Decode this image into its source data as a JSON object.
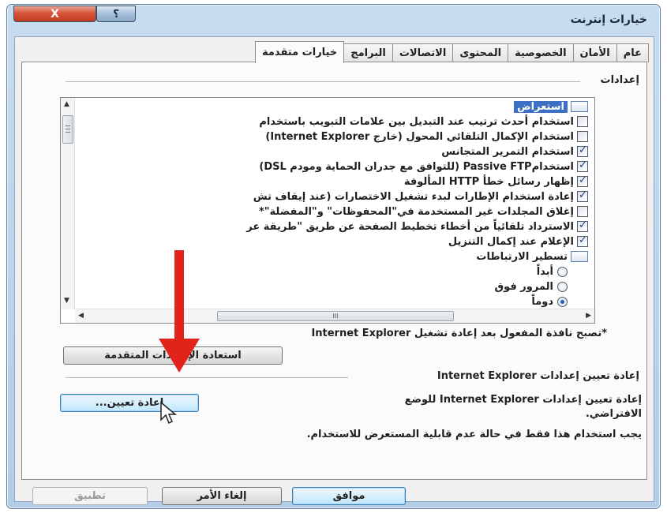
{
  "window": {
    "title": "خيارات إنترنت",
    "close_glyph": "X",
    "help_glyph": "؟"
  },
  "tabs": [
    {
      "label": "عام"
    },
    {
      "label": "الأمان"
    },
    {
      "label": "الخصوصية"
    },
    {
      "label": "المحتوى"
    },
    {
      "label": "الاتصالات"
    },
    {
      "label": "البرامج"
    },
    {
      "label": "خيارات متقدمة",
      "active": true
    }
  ],
  "settings": {
    "label": "إعدادات",
    "category": "استعراض",
    "items": [
      {
        "label": "استخدام أحدث ترتيب عند التبديل بين علامات التبويب باستخدام",
        "checked": false
      },
      {
        "label": "استخدام الإكمال التلقائي المحول (خارج Internet Explorer)",
        "checked": false
      },
      {
        "label": "استخدام التمرير المتجانس",
        "checked": true
      },
      {
        "label": "استخدامPassive FTP (للتوافق مع جدران الحماية ومودم DSL)",
        "checked": true
      },
      {
        "label": "إظهار رسائل خطأ HTTP المألوفة",
        "checked": true
      },
      {
        "label": "إعادة استخدام الإطارات لبدء تشغيل الاختصارات (عند إيقاف تش",
        "checked": true
      },
      {
        "label": "إغلاق المجلدات غير المستخدمة في\"المحفوظات\" و\"المفضلة\"*",
        "checked": false
      },
      {
        "label": "الاسترداد تلقائياً من أخطاء تخطيط الصفحة عن طريق \"طريقة عر",
        "checked": true
      },
      {
        "label": "الإعلام عند إكمال التنزيل",
        "checked": true
      }
    ],
    "subcategory": "تسطير الارتباطات",
    "radios": [
      {
        "label": "أبداً",
        "selected": false
      },
      {
        "label": "المرور فوق",
        "selected": false
      },
      {
        "label": "دوماً",
        "selected": true
      }
    ],
    "hscroll_grip": "III"
  },
  "restart_note": "*تصبح نافذة المفعول بعد إعادة تشغيل Internet Explorer",
  "restore_button": "استعادة الإعدادات المتقدمة",
  "reset_section": {
    "label": "إعادة تعيين إعدادات Internet Explorer",
    "desc_line1": "إعادة تعيين إعدادات Internet Explorer للوضع",
    "desc_line2": "الافتراضي.",
    "button": "إعادة تعيين...",
    "warning": "يجب استخدام هذا فقط في حالة عدم قابلية المستعرض للاستخدام."
  },
  "footer": {
    "ok": "موافق",
    "cancel": "إلغاء الأمر",
    "apply": "تطبيق"
  },
  "colors": {
    "arrow": "#e2231a",
    "selection": "#3d6fc5"
  }
}
